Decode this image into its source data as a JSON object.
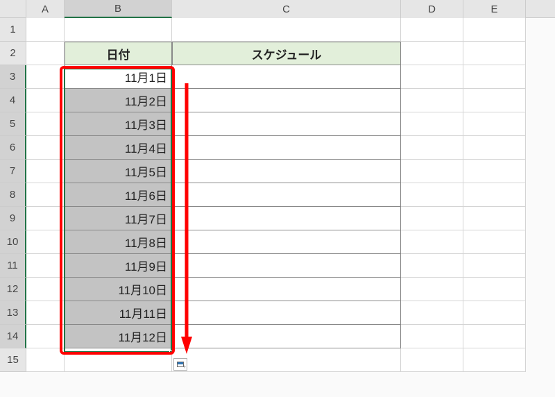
{
  "columns": [
    "A",
    "B",
    "C",
    "D",
    "E"
  ],
  "rowCount": 15,
  "headers": {
    "B": "日付",
    "C": "スケジュール"
  },
  "dates": [
    "11月1日",
    "11月2日",
    "11月3日",
    "11月4日",
    "11月5日",
    "11月6日",
    "11月7日",
    "11月8日",
    "11月9日",
    "11月10日",
    "11月11日",
    "11月12日"
  ],
  "selectedColumn": "B",
  "activeCell": "B3",
  "selectionRange": "B3:B14"
}
